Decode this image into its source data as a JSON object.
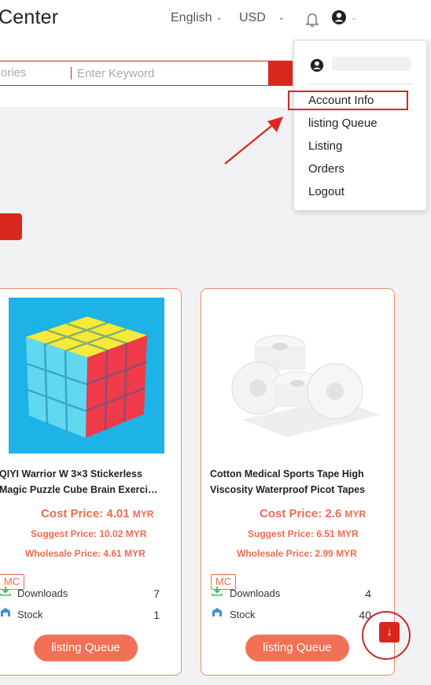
{
  "header": {
    "brand": "Center",
    "language": "English",
    "currency": "USD"
  },
  "search": {
    "category_placeholder": "ories",
    "keyword_placeholder": "Enter Keyword"
  },
  "dropdown": {
    "items": [
      "Account Info",
      "listing Queue",
      "Listing",
      "Orders",
      "Logout"
    ]
  },
  "products": [
    {
      "title_line1": "QIYI Warrior W 3×3 Stickerless",
      "title_line2": "Magic Puzzle Cube Brain Exerci…",
      "cost_price": "Cost Price: 4.01",
      "suggest_price": "Suggest Price: 10.02",
      "wholesale_price": "Wholesale Price: 4.61",
      "currency": "MYR",
      "badge": "MC",
      "downloads_label": "Downloads",
      "downloads": "7",
      "stock_label": "Stock",
      "stock": "1",
      "button": "listing Queue"
    },
    {
      "title_line1": "Cotton Medical Sports Tape High",
      "title_line2": "Viscosity Waterproof Picot Tapes",
      "cost_price": "Cost Price: 2.6",
      "suggest_price": "Suggest Price: 6.51",
      "wholesale_price": "Wholesale Price: 2.99",
      "currency": "MYR",
      "badge": "MC",
      "downloads_label": "Downloads",
      "downloads": "4",
      "stock_label": "Stock",
      "stock": "40",
      "button": "listing Queue"
    }
  ],
  "colors": {
    "accent": "#d9271e",
    "price": "#ee6b4d",
    "button": "#f07155",
    "annotation": "#d9271e"
  },
  "icons": [
    "chevron-down-icon",
    "bell-icon",
    "user-icon",
    "download-icon",
    "stock-icon",
    "arrow-down-icon"
  ]
}
